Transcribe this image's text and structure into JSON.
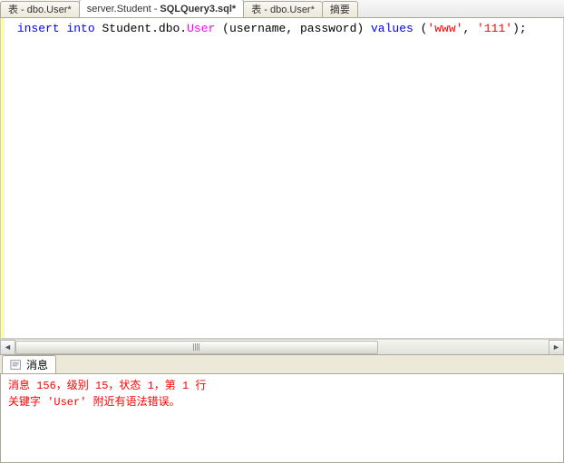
{
  "tabs": [
    {
      "label": "表 - dbo.User*"
    },
    {
      "label_prefix": "server.Student",
      "label_sep": " - ",
      "label_suffix": "SQLQuery3.sql*"
    },
    {
      "label": "表 - dbo.User*"
    },
    {
      "label": "摘要"
    }
  ],
  "editor": {
    "code": {
      "kw1": "insert",
      "kw2": "into",
      "obj1": "Student",
      "dot1": ".",
      "obj2": "dbo",
      "dot2": ".",
      "tbl": "User",
      "paren_open": " (",
      "col1": "username",
      "comma1": ", ",
      "col2": "password",
      "paren_close": ") ",
      "kw3": "values",
      "paren2_open": " (",
      "str1": "'www'",
      "comma2": ", ",
      "str2": "'111'",
      "paren2_close": ");"
    }
  },
  "messages": {
    "tab_label": "消息",
    "line1": "消息 156，级别 15，状态 1，第 1 行",
    "line2": "关键字 'User' 附近有语法错误。"
  }
}
